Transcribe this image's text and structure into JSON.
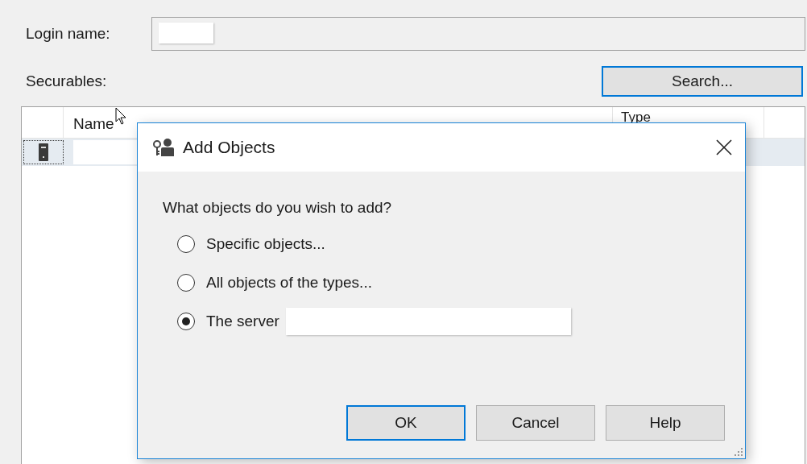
{
  "form": {
    "login_label": "Login name:",
    "securables_label": "Securables:",
    "search_button": {
      "label": "Search...",
      "focused": true
    }
  },
  "table": {
    "columns": [
      "Name",
      "Type"
    ],
    "rows": [
      {
        "selected": true
      }
    ]
  },
  "dialog": {
    "title": "Add Objects",
    "prompt": "What objects do you wish to add?",
    "options": [
      {
        "label": "Specific objects...",
        "selected": false,
        "kind": "plain"
      },
      {
        "label": "All objects of the types...",
        "selected": false,
        "kind": "plain"
      },
      {
        "label": "The server",
        "selected": true,
        "kind": "field"
      }
    ],
    "buttons": [
      {
        "label": "OK",
        "focused": true
      },
      {
        "label": "Cancel",
        "focused": false
      },
      {
        "label": "Help",
        "focused": false
      }
    ]
  }
}
